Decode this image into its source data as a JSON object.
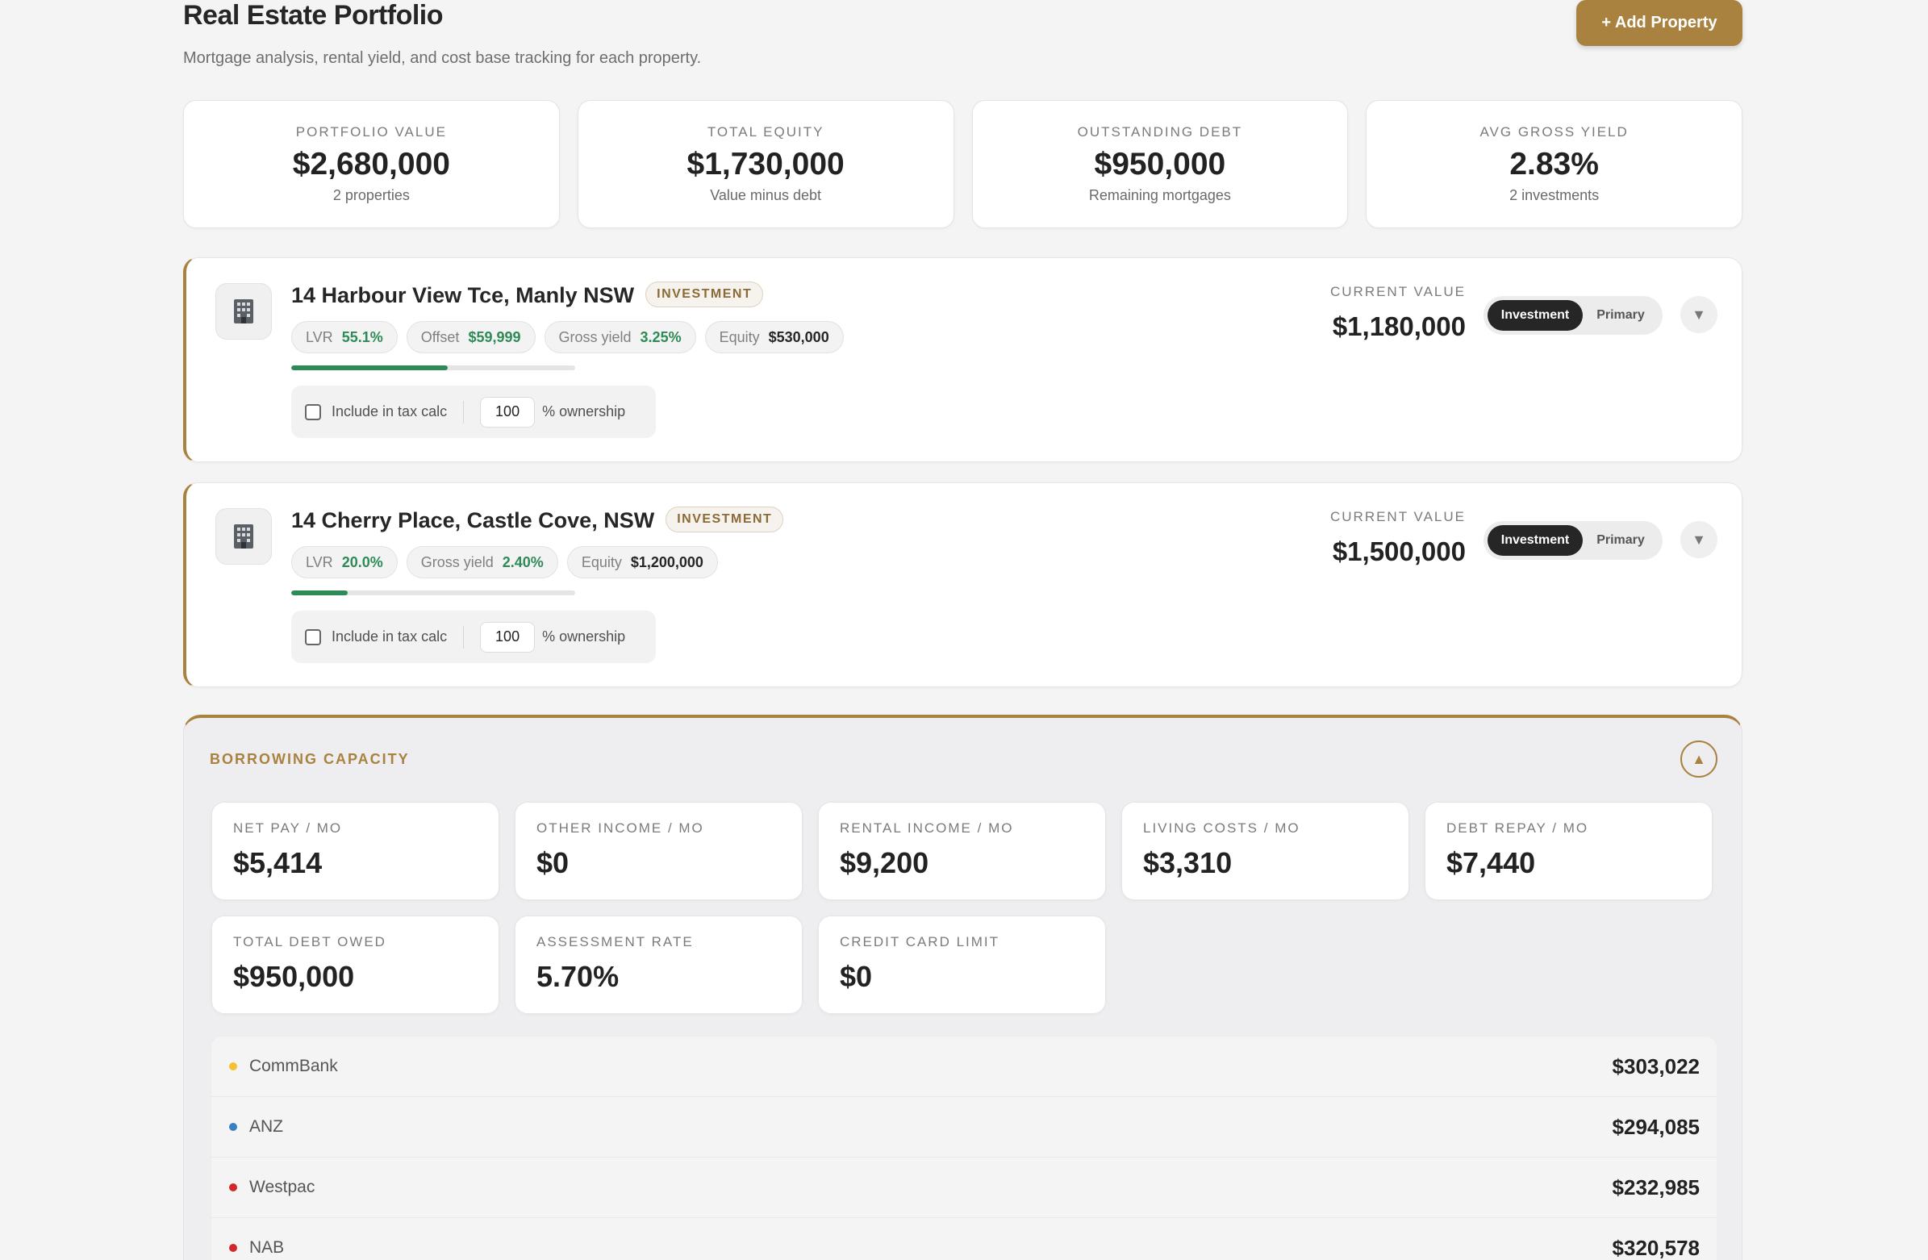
{
  "header": {
    "title": "Real Estate Portfolio",
    "subtitle": "Mortgage analysis, rental yield, and cost base tracking for each property.",
    "add_button": "+ Add Property"
  },
  "stats": [
    {
      "label": "PORTFOLIO VALUE",
      "value": "$2,680,000",
      "sub": "2 properties"
    },
    {
      "label": "TOTAL EQUITY",
      "value": "$1,730,000",
      "sub": "Value minus debt"
    },
    {
      "label": "OUTSTANDING DEBT",
      "value": "$950,000",
      "sub": "Remaining mortgages"
    },
    {
      "label": "AVG GROSS YIELD",
      "value": "2.83%",
      "sub": "2 investments"
    }
  ],
  "properties": [
    {
      "address": "14 Harbour View Tce, Manly NSW",
      "badge": "INVESTMENT",
      "lvr_label": "LVR",
      "lvr": "55.1%",
      "lvr_fraction": 0.551,
      "offset_label": "Offset",
      "offset": "$59,999",
      "yield_label": "Gross yield",
      "yield": "3.25%",
      "equity_label": "Equity",
      "equity": "$530,000",
      "tax_label": "Include in tax calc",
      "ownership": "100",
      "ownership_label": "% ownership",
      "current_value_label": "CURRENT VALUE",
      "current_value": "$1,180,000",
      "toggle_on": "Investment",
      "toggle_off": "Primary"
    },
    {
      "address": "14 Cherry Place, Castle Cove, NSW",
      "badge": "INVESTMENT",
      "lvr_label": "LVR",
      "lvr": "20.0%",
      "lvr_fraction": 0.2,
      "yield_label": "Gross yield",
      "yield": "2.40%",
      "equity_label": "Equity",
      "equity": "$1,200,000",
      "tax_label": "Include in tax calc",
      "ownership": "100",
      "ownership_label": "% ownership",
      "current_value_label": "CURRENT VALUE",
      "current_value": "$1,500,000",
      "toggle_on": "Investment",
      "toggle_off": "Primary"
    }
  ],
  "borrowing": {
    "title": "BORROWING CAPACITY",
    "metrics": [
      {
        "label": "NET PAY / MO",
        "value": "$5,414"
      },
      {
        "label": "OTHER INCOME / MO",
        "value": "$0"
      },
      {
        "label": "RENTAL INCOME / MO",
        "value": "$9,200"
      },
      {
        "label": "LIVING COSTS / MO",
        "value": "$3,310"
      },
      {
        "label": "DEBT REPAY / MO",
        "value": "$7,440"
      },
      {
        "label": "TOTAL DEBT OWED",
        "value": "$950,000"
      },
      {
        "label": "ASSESSMENT RATE",
        "value": "5.70%"
      },
      {
        "label": "CREDIT CARD LIMIT",
        "value": "$0"
      }
    ],
    "lenders": [
      {
        "name": "CommBank",
        "amount": "$303,022",
        "color": "#f2c230"
      },
      {
        "name": "ANZ",
        "amount": "$294,085",
        "color": "#3a7fc1"
      },
      {
        "name": "Westpac",
        "amount": "$232,985",
        "color": "#d0292b"
      },
      {
        "name": "NAB",
        "amount": "$320,578",
        "color": "#d0292b"
      }
    ]
  },
  "colors": {
    "accent": "#a9823f",
    "positive": "#2e8b57",
    "dark": "#262626"
  }
}
